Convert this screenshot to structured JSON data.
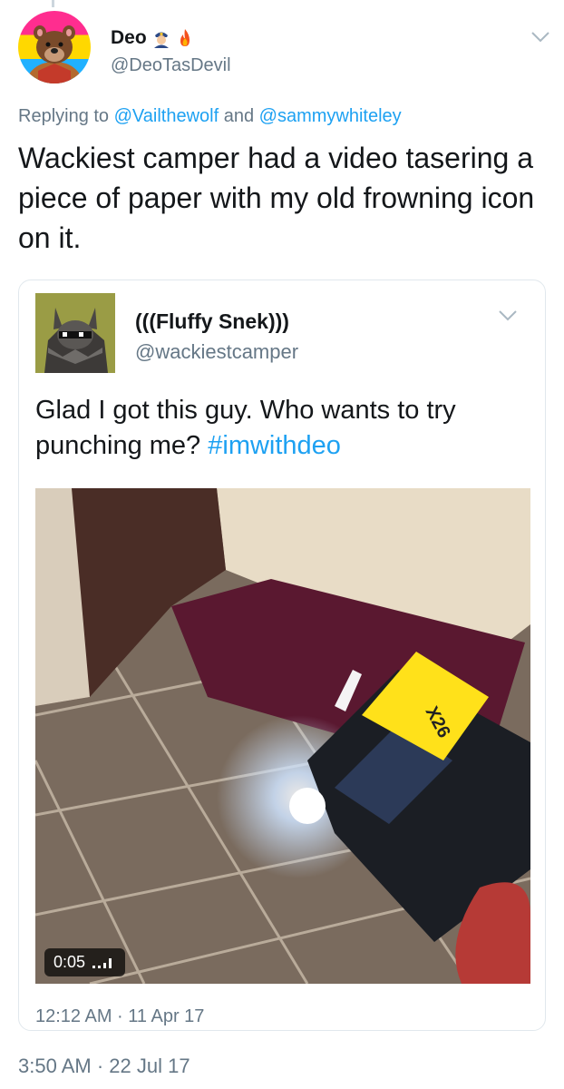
{
  "tweet": {
    "author_name": "Deo",
    "author_handle": "@DeoTasDevil",
    "reply_prefix": "Replying to",
    "reply_to_1": "@Vailthewolf",
    "reply_joiner": "and",
    "reply_to_2": "@sammywhiteley",
    "text": "Wackiest camper had a video tasering a piece of paper with my old frowning icon on it.",
    "timestamp": "3:50 AM · 22 Jul 17",
    "name_icons": [
      "police-officer-icon",
      "fire-icon"
    ]
  },
  "quoted": {
    "author_name": "(((Fluffy Snek)))",
    "author_handle": "@wackiestcamper",
    "text_main": "Glad I got this guy.  Who wants to try punching me? ",
    "hashtag": "#imwithdeo",
    "video_duration": "0:05",
    "video_device_label": "X26",
    "timestamp": "12:12 AM · 11 Apr 17"
  },
  "colors": {
    "link": "#1da1f2",
    "secondary_text": "#657786",
    "border": "#e1e8ed"
  }
}
